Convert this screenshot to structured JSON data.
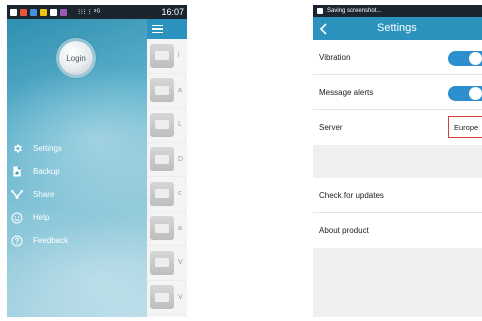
{
  "left_screen": {
    "status_bar": {
      "time": "16:07",
      "center_text": "⁝⁝⁝ ⁝ ³ᴳ"
    },
    "drawer": {
      "login_label": "Login",
      "menu": [
        {
          "label": "Settings",
          "icon": "gear-icon"
        },
        {
          "label": "Backup",
          "icon": "backup-file-icon"
        },
        {
          "label": "Share",
          "icon": "share-icon"
        },
        {
          "label": "Help",
          "icon": "smiley-help-icon"
        },
        {
          "label": "Feedback",
          "icon": "question-icon"
        }
      ]
    },
    "list": {
      "rows": [
        {
          "letter": "i"
        },
        {
          "letter": "a"
        },
        {
          "letter": "L"
        },
        {
          "letter": "D"
        },
        {
          "letter": "c"
        },
        {
          "letter": "a"
        },
        {
          "letter": "V"
        },
        {
          "letter": "V"
        }
      ]
    }
  },
  "right_screen": {
    "status_bar": {
      "notification": "Saving screenshot..."
    },
    "appbar": {
      "title": "Settings"
    },
    "group1": [
      {
        "label": "Vibration",
        "type": "toggle",
        "on": true
      },
      {
        "label": "Message alerts",
        "type": "toggle",
        "on": true
      },
      {
        "label": "Server",
        "type": "value",
        "value": "Europe"
      }
    ],
    "group2": [
      {
        "label": "Check for updates"
      },
      {
        "label": "About product"
      }
    ]
  },
  "colors": {
    "primary": "#2b93be",
    "toggle_on": "#2e8fcf",
    "highlight_border": "#d0443a",
    "status_bar": "#1b2530"
  }
}
